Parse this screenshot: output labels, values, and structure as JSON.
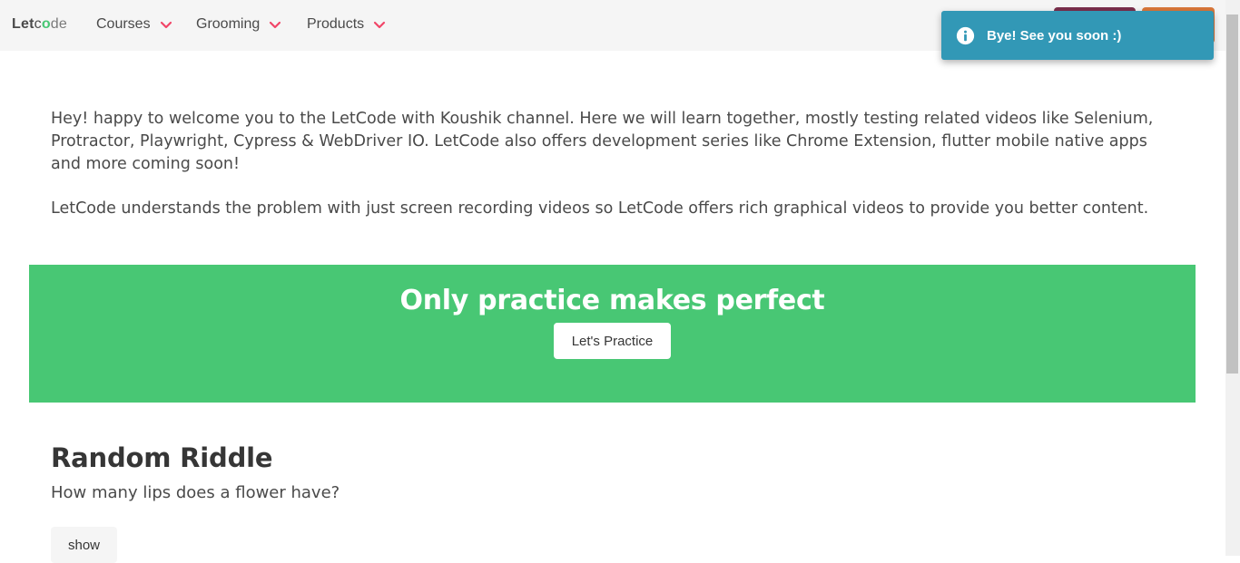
{
  "navbar": {
    "brand": {
      "part1": "Let",
      "part2": "c",
      "part3": "o",
      "part4": "de"
    },
    "items": [
      {
        "label": "Courses"
      },
      {
        "label": "Grooming"
      },
      {
        "label": "Products"
      }
    ]
  },
  "toast": {
    "message": "Bye! See you soon :)",
    "icon": "info-icon",
    "color": "#3298b6"
  },
  "intro": {
    "paragraph1": "Hey! happy to welcome you to the LetCode with Koushik channel. Here we will learn together, mostly testing related videos like Selenium, Protractor, Playwright, Cypress & WebDriver IO. LetCode also offers development series like Chrome Extension, flutter mobile native apps and more coming soon!",
    "paragraph2": "LetCode understands the problem with just screen recording videos so LetCode offers rich graphical videos to provide you better content."
  },
  "hero": {
    "title": "Only practice makes perfect",
    "button_label": "Let's Practice",
    "color": "#48c774"
  },
  "riddle": {
    "title": "Random Riddle",
    "question": "How many lips does a flower have?",
    "show_label": "show"
  }
}
